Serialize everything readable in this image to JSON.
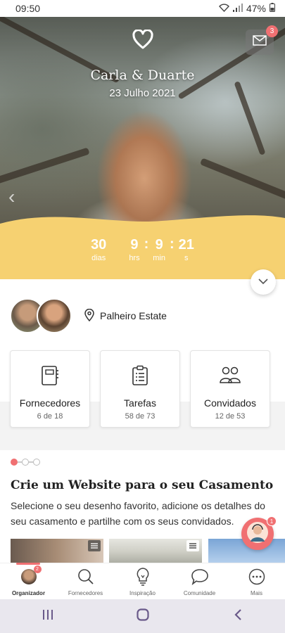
{
  "status_bar": {
    "time": "09:50",
    "battery": "47%"
  },
  "hero": {
    "couple_names": "Carla & Duarte",
    "date": "23 Julho 2021",
    "mail_badge": "3"
  },
  "countdown": {
    "days": {
      "value": "30",
      "label": "dias"
    },
    "hours": {
      "value": "9",
      "label": "hrs"
    },
    "minutes": {
      "value": "9",
      "label": "min"
    },
    "seconds": {
      "value": "21",
      "label": "s"
    }
  },
  "venue": "Palheiro Estate",
  "cards": [
    {
      "title": "Fornecedores",
      "count": "6 de 18",
      "icon": "notebook-icon"
    },
    {
      "title": "Tarefas",
      "count": "58 de 73",
      "icon": "checklist-icon"
    },
    {
      "title": "Convidados",
      "count": "12 de 53",
      "icon": "guests-icon"
    }
  ],
  "promo": {
    "title": "Crie um Website para o seu Casamento",
    "description": "Selecione o seu desenho favorito, adicione os detalhes do seu casamento e partilhe com os seus convidados."
  },
  "chat_badge": "1",
  "bottom_nav": [
    {
      "label": "Organizador",
      "icon": "avatar",
      "active": true,
      "badge": "2"
    },
    {
      "label": "Fornecedores",
      "icon": "search-icon",
      "active": false
    },
    {
      "label": "Inspiração",
      "icon": "lightbulb-icon",
      "active": false
    },
    {
      "label": "Comunidade",
      "icon": "chat-icon",
      "active": false
    },
    {
      "label": "Mais",
      "icon": "more-icon",
      "active": false
    }
  ],
  "colors": {
    "accent": "#f07072",
    "countdown_bg": "#f6d171"
  }
}
